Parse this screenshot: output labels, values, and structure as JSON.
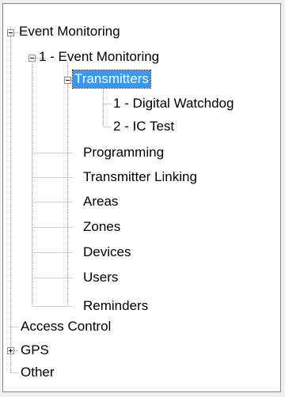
{
  "tree": {
    "nodes": [
      {
        "label": "Event Monitoring",
        "state": "expanded"
      },
      {
        "label": "1 - Event Monitoring",
        "state": "expanded"
      },
      {
        "label": "Transmitters",
        "state": "expanded",
        "selected": true
      },
      {
        "label": "1 - Digital Watchdog"
      },
      {
        "label": "2 - IC Test"
      },
      {
        "label": "Programming"
      },
      {
        "label": "Transmitter Linking"
      },
      {
        "label": "Areas"
      },
      {
        "label": "Zones"
      },
      {
        "label": "Devices"
      },
      {
        "label": "Users"
      },
      {
        "label": "Reminders"
      },
      {
        "label": "Access Control"
      },
      {
        "label": "GPS",
        "state": "collapsed"
      },
      {
        "label": "Other"
      }
    ]
  },
  "colors": {
    "selection": "#3399ff",
    "border": "#828790",
    "tree_lines": "#a0a0a0"
  }
}
